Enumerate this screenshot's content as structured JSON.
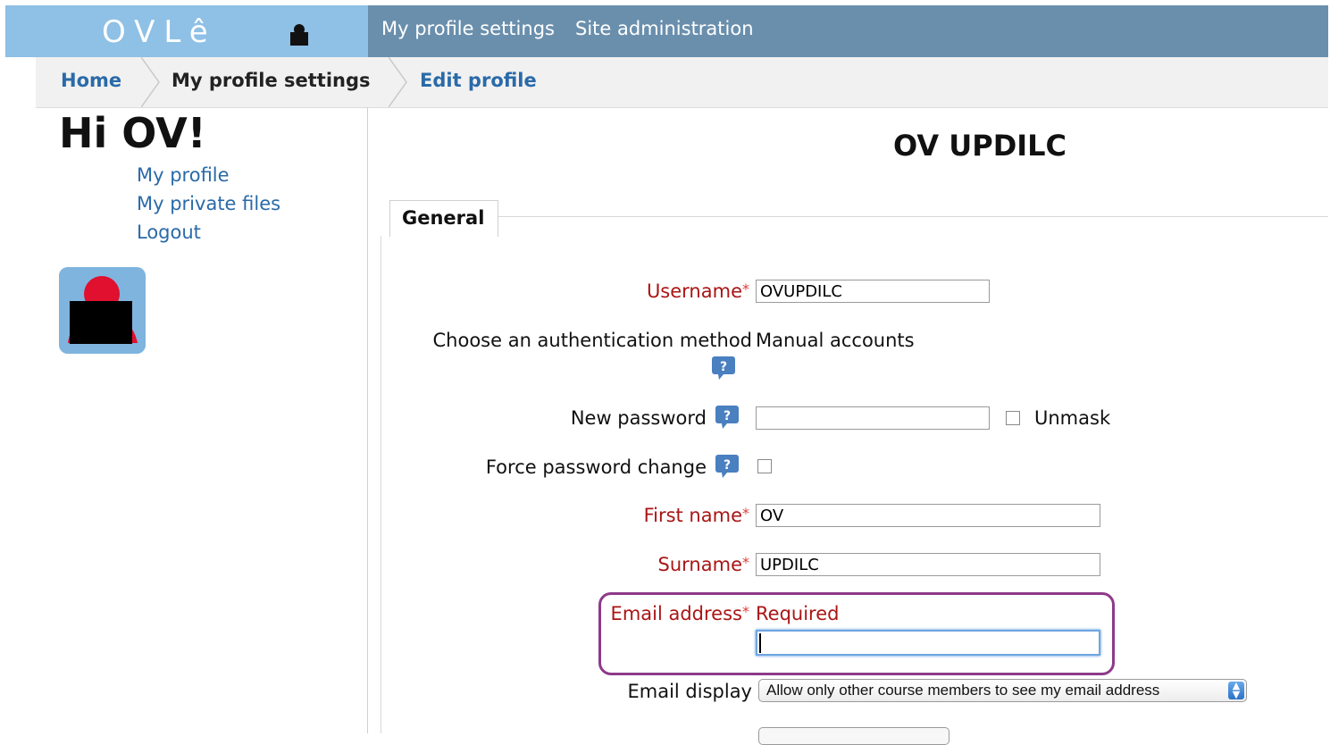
{
  "header": {
    "logo_text": "OVLê",
    "nav": [
      "My profile settings",
      "Site administration"
    ]
  },
  "breadcrumb": {
    "home": "Home",
    "current": "My profile settings",
    "edit": "Edit profile"
  },
  "sidebar": {
    "greeting": "Hi OV!",
    "links": [
      "My profile",
      "My private files",
      "Logout"
    ]
  },
  "page": {
    "title": "OV UPDILC",
    "legend": "General"
  },
  "form": {
    "username_label": "Username",
    "username_value": "OVUPDILC",
    "auth_label": "Choose an authentication method",
    "auth_value": "Manual accounts",
    "new_password_label": "New password",
    "unmask_label": "Unmask",
    "force_password_label": "Force password change",
    "firstname_label": "First name",
    "firstname_value": "OV",
    "surname_label": "Surname",
    "surname_value": "UPDILC",
    "email_label": "Email address",
    "email_required_text": "Required",
    "email_value": "",
    "email_display_label": "Email display",
    "email_display_value": "Allow only other course members to see my email address",
    "required_star": "*"
  },
  "colors": {
    "logo_bg": "#8fc0e6",
    "topnav_bg": "#6a8fad",
    "link": "#2a6aa8",
    "required": "#aa1515",
    "highlight": "#8e3a8a"
  }
}
